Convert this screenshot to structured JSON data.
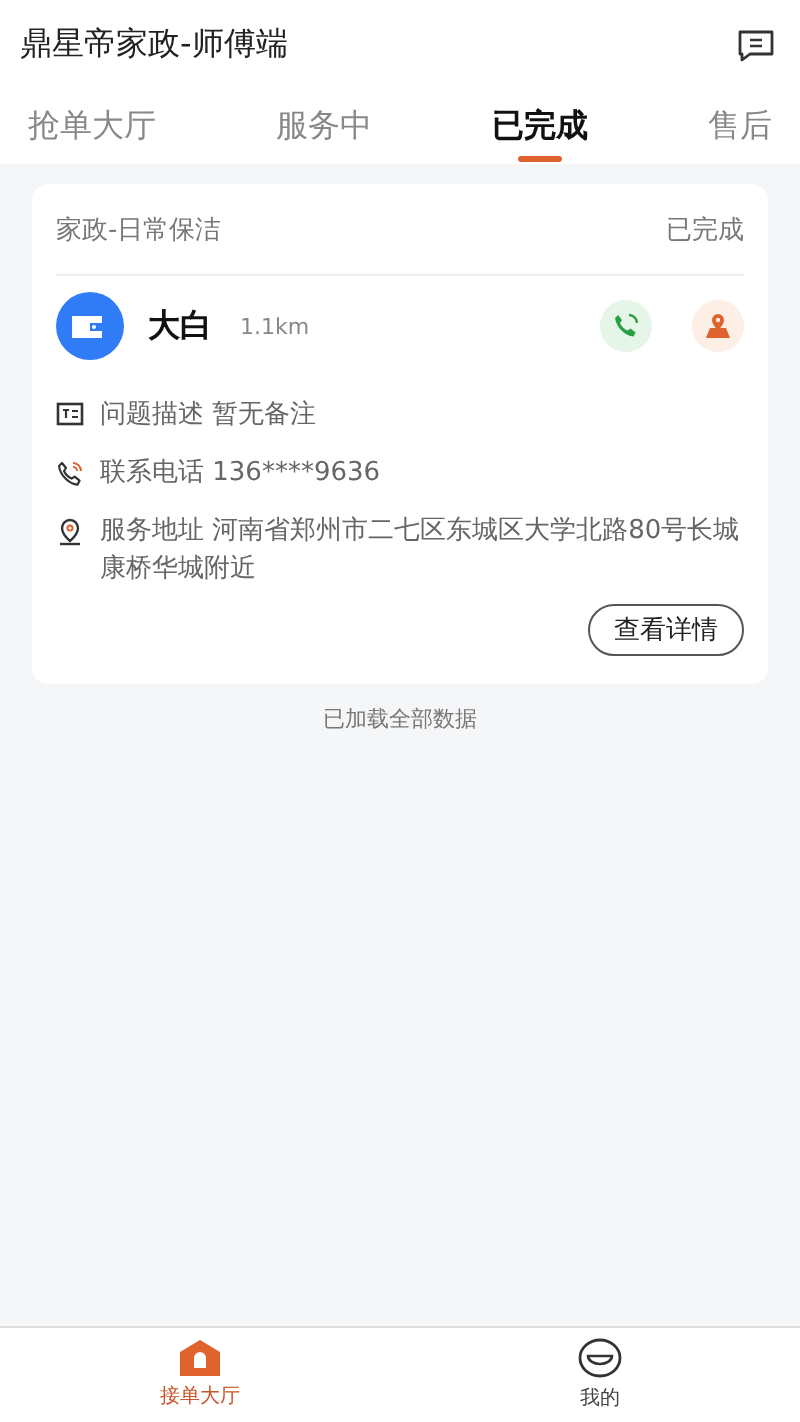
{
  "header": {
    "title": "鼎星帝家政-师傅端"
  },
  "tabs": [
    {
      "label": "抢单大厅",
      "selected": false
    },
    {
      "label": "服务中",
      "selected": false
    },
    {
      "label": "已完成",
      "selected": true
    },
    {
      "label": "售后",
      "selected": false
    }
  ],
  "orders": [
    {
      "category": "家政-日常保洁",
      "status": "已完成",
      "customer": "大白",
      "distance": "1.1km",
      "details": [
        {
          "kind": "note",
          "text": "问题描述 暂无备注"
        },
        {
          "kind": "phone",
          "text": "联系电话 136****9636"
        },
        {
          "kind": "address",
          "text": "服务地址 河南省郑州市二七区东城区大学北路80号长城康桥华城附近"
        }
      ],
      "button": "查看详情"
    }
  ],
  "list_footer": "已加载全部数据",
  "bottom_nav": [
    {
      "kind": "home",
      "label": "接单大厅",
      "selected": true
    },
    {
      "kind": "profile",
      "label": "我的",
      "selected": false
    }
  ]
}
